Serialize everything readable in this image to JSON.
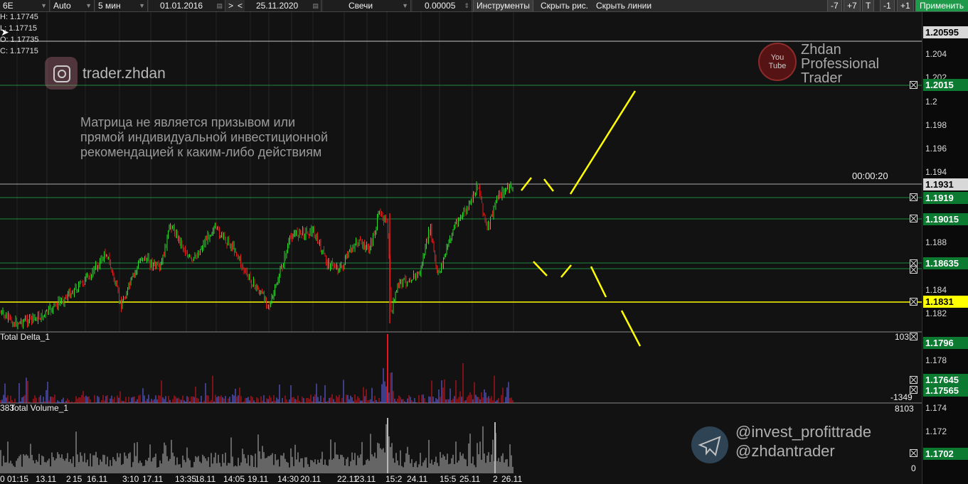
{
  "toolbar": {
    "symbol": "6E",
    "mode": "Auto",
    "timeframe": "5 мин",
    "date_from": "01.01.2016",
    "nav_next": ">",
    "nav_prev": "<",
    "date_to": "25.11.2020",
    "chart_type": "Свечи",
    "tick_size": "0.00005",
    "tools": "Инструменты",
    "hide_drawings": "Скрыть рис.",
    "hide_lines": "Скрыть линии",
    "minus7": "-7",
    "plus7": "+7",
    "t": "T",
    "minus1": "-1",
    "plus1": "+1",
    "apply": "Применить"
  },
  "ohlc": {
    "h": "H: 1.17745",
    "l": "L: 1.17715",
    "o": "O: 1.17735",
    "c": "C: 1.17715"
  },
  "watermarks": {
    "instagram": "trader.zhdan",
    "disclaimer_1": "Матрица не является призывом или",
    "disclaimer_2": "прямой индивидуальной инвестиционной",
    "disclaimer_3": "рекомендацией к каким-либо действиям",
    "youtube_logo": "You Tube",
    "brand_1": "Zhdan",
    "brand_2": "Professional",
    "brand_3": "Trader",
    "telegram_1": "@invest_profittrade",
    "telegram_2": "@zhdantrader"
  },
  "timer": "00:00:20",
  "panels": {
    "delta_name": "Total Delta_1",
    "delta_max": "103",
    "delta_min": "-1349",
    "volume_name": "Total Volume_1",
    "volume_prefix": "383",
    "volume_max": "8103",
    "volume_min": "0"
  },
  "price_ticks": [
    "1.204",
    "1.202",
    "1.2",
    "1.198",
    "1.196",
    "1.194",
    "1.188",
    "1.184",
    "1.182",
    "1.178",
    "1.174",
    "1.172"
  ],
  "price_labels": [
    {
      "text": "1.20595",
      "style": "white"
    },
    {
      "text": "1.2015",
      "style": "green"
    },
    {
      "text": "1.1931",
      "style": "white"
    },
    {
      "text": "1.1919",
      "style": "green"
    },
    {
      "text": "1.19015",
      "style": "green"
    },
    {
      "text": "1.18635",
      "style": "green"
    },
    {
      "text": "1.1831",
      "style": "yellow"
    },
    {
      "text": "1.1796",
      "style": "green"
    },
    {
      "text": "1.17645",
      "style": "green"
    },
    {
      "text": "1.17565",
      "style": "green"
    },
    {
      "text": "1.1702",
      "style": "green"
    }
  ],
  "time_labels": [
    "0 01:15",
    "13.11",
    "2",
    "15",
    "16.11",
    "3:10",
    "17.11",
    "13:35",
    "18.11",
    "14:05",
    "19.11",
    "14:30",
    "20.11",
    "22.11",
    "23.11",
    "15:2",
    "24.11",
    "15:5",
    "25.11",
    "2",
    "26.11"
  ],
  "colors": {
    "bull": "#2fd62f",
    "bear": "#e01c1c",
    "level_green": "#1e8a3c",
    "level_yellow": "#ffff00",
    "sketch": "#ffff00",
    "delta_neg": "#e8141e",
    "delta_pos": "#6a6aff",
    "volume": "#b8b8b8"
  },
  "icons": [
    "instagram-icon",
    "youtube-icon",
    "telegram-icon",
    "close-icon",
    "cursor-icon"
  ]
}
